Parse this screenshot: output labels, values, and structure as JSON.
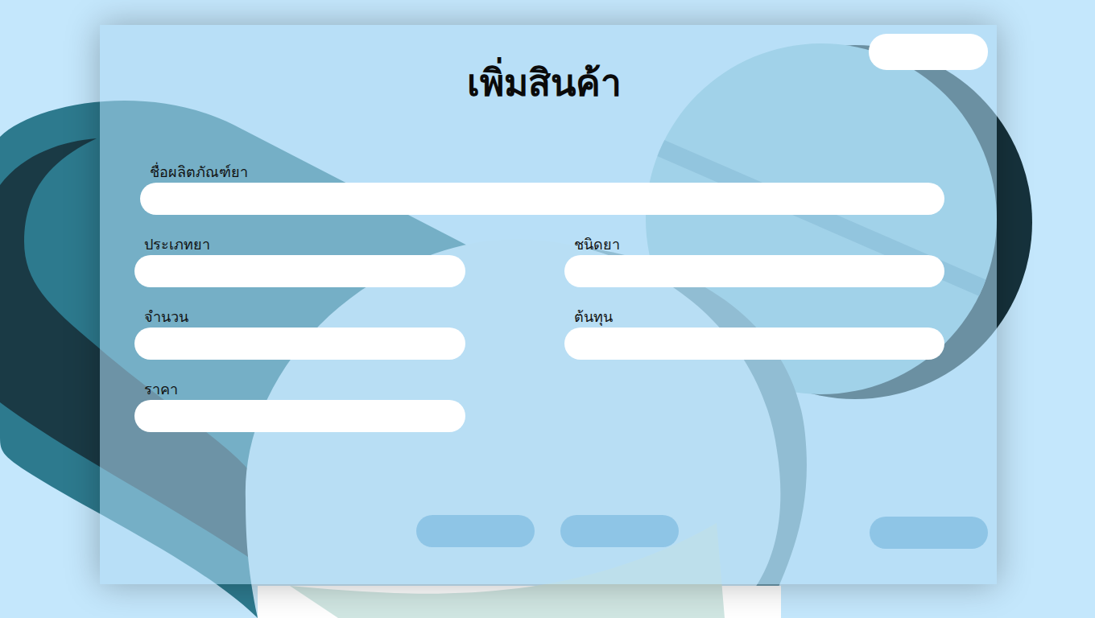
{
  "window": {
    "title": "เพิ่มสินค้า"
  },
  "top_button": {
    "label": ""
  },
  "name_field": {
    "label": "ชื่อผลิตภัณฑ์ยา",
    "value": ""
  },
  "fields": [
    {
      "label": "ประเภทยา",
      "value": ""
    },
    {
      "label": "ชนิดยา",
      "value": ""
    },
    {
      "label": "จำนวน",
      "value": ""
    },
    {
      "label": "ต้นทุน",
      "value": ""
    },
    {
      "label": "ราคา",
      "value": ""
    }
  ],
  "buttons": [
    {
      "label": ""
    },
    {
      "label": ""
    },
    {
      "label": ""
    }
  ]
}
